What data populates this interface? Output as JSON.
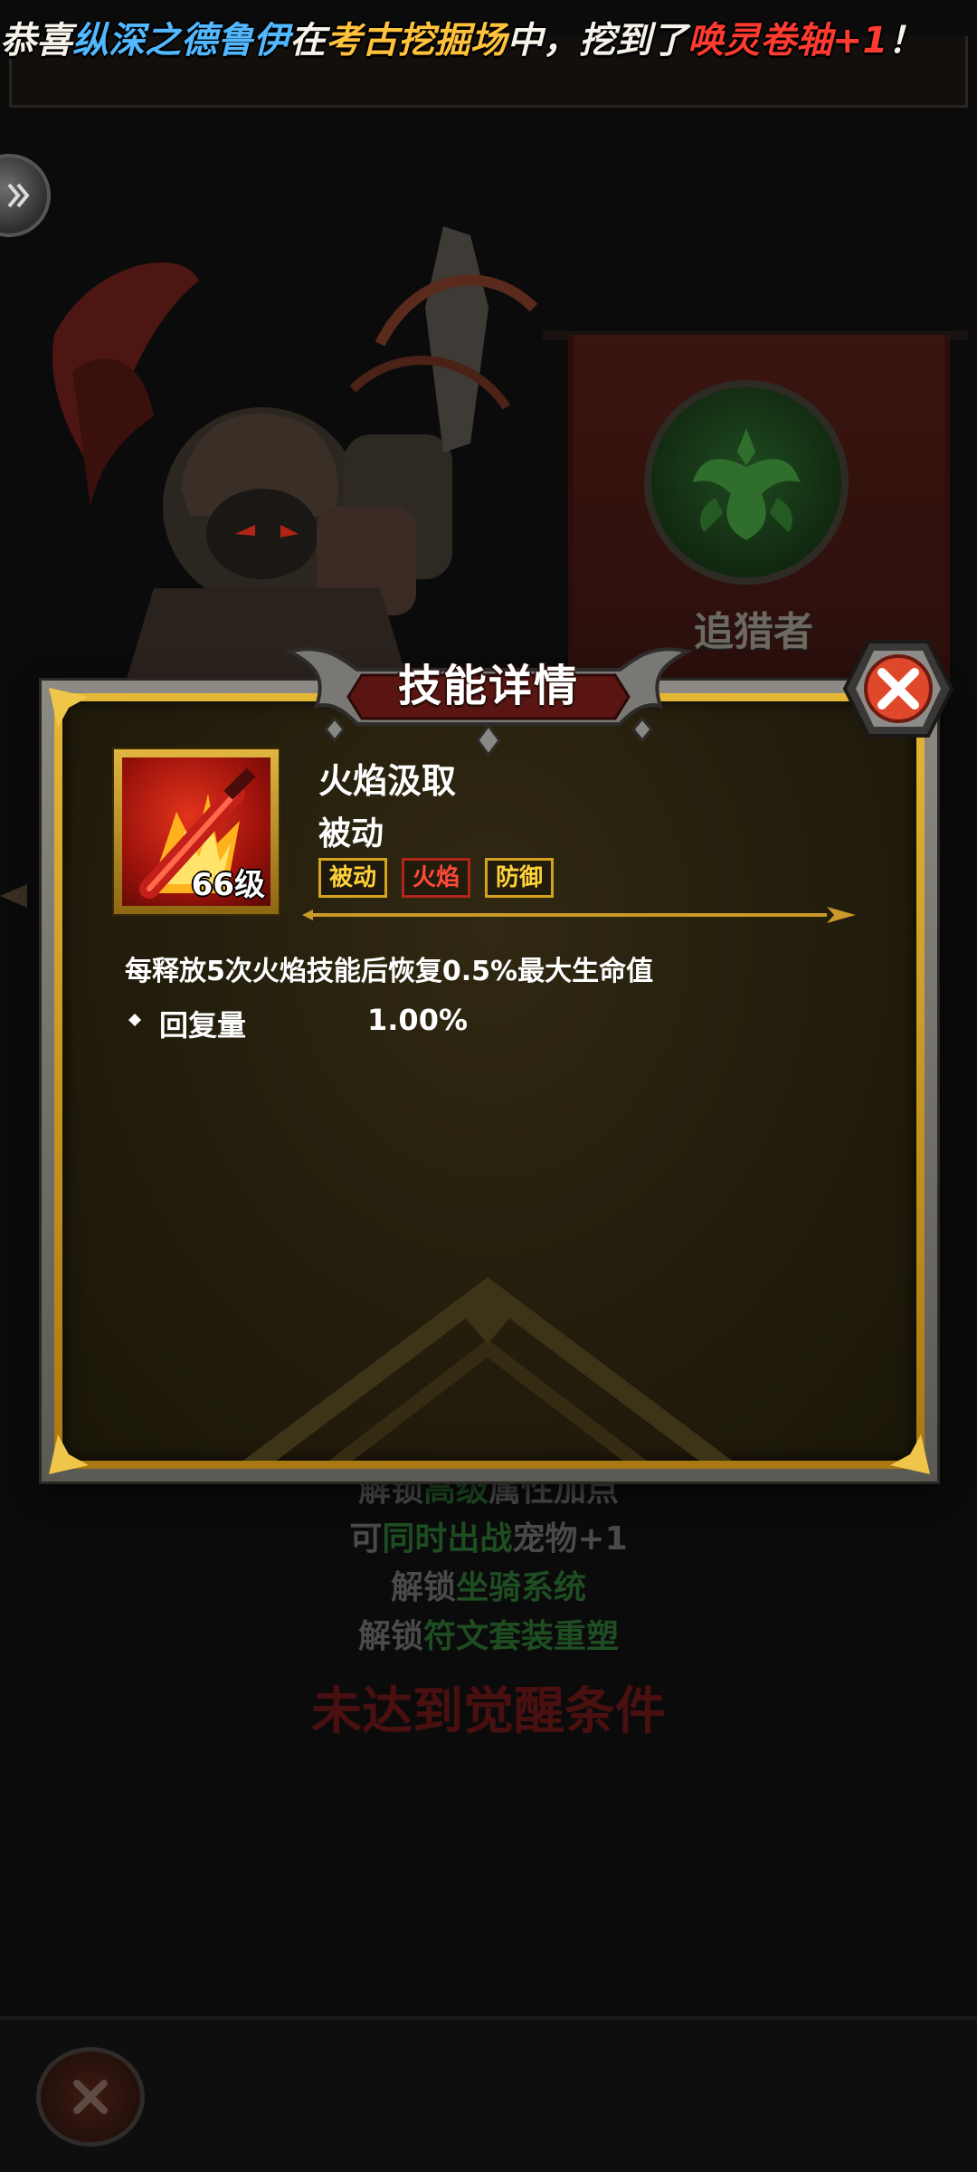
{
  "announcement": {
    "segments": [
      {
        "text": "恭喜",
        "color": "#f6f3ea"
      },
      {
        "text": "纵深之德鲁伊",
        "color": "#52b8ff"
      },
      {
        "text": "在",
        "color": "#f6f3ea"
      },
      {
        "text": "考古挖掘场",
        "color": "#ffc23a"
      },
      {
        "text": "中，挖到了",
        "color": "#f6f3ea"
      },
      {
        "text": "唤灵卷轴+1",
        "color": "#ff3b2f"
      },
      {
        "text": "！",
        "color": "#f6f3ea"
      }
    ]
  },
  "background": {
    "class_name": "追猎者",
    "unlock_lines": [
      {
        "prefix": "解锁",
        "highlight": "高级",
        "suffix": "属性加点"
      },
      {
        "prefix": "可",
        "highlight": "同时出战",
        "suffix": "宠物+1"
      },
      {
        "prefix": "解锁",
        "highlight": "坐骑系统",
        "suffix": ""
      },
      {
        "prefix": "解锁",
        "highlight": "符文套装重塑",
        "suffix": ""
      }
    ],
    "awaken_warning": "未达到觉醒条件"
  },
  "dialog": {
    "title": "技能详情",
    "skill": {
      "name": "火焰汲取",
      "type": "被动",
      "level": "66级",
      "tags": [
        {
          "label": "被动",
          "style": "gold"
        },
        {
          "label": "火焰",
          "style": "red"
        },
        {
          "label": "防御",
          "style": "gold"
        }
      ],
      "description": "每释放5次火焰技能后恢复0.5%最大生命值",
      "stats": [
        {
          "label": "回复量",
          "value": "1.00%"
        }
      ]
    }
  },
  "icons": {
    "close": "close-x-icon",
    "expand": "double-chevron-right-icon",
    "skill": "flaming-sword-icon",
    "emblem": "antler-crest-icon"
  },
  "colors": {
    "gold_frame": "#e5b636",
    "close_red": "#e0482c",
    "tag_gold": "#ffd23a",
    "tag_red": "#ff4a3a"
  }
}
